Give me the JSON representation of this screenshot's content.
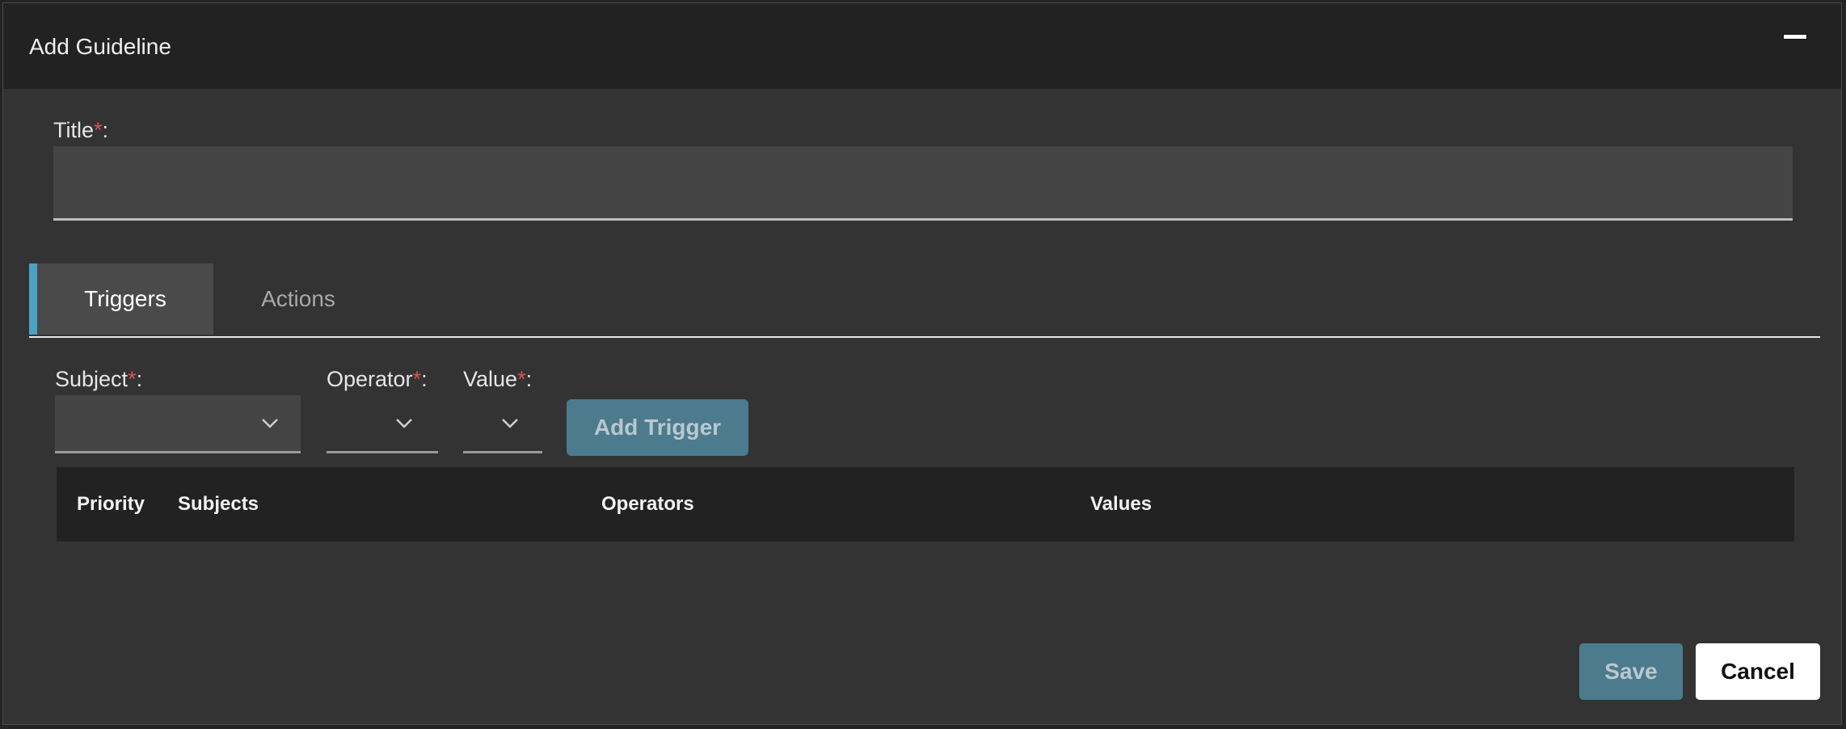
{
  "dialog": {
    "title": "Add Guideline"
  },
  "title_field": {
    "label": "Title",
    "required_mark": "*",
    "suffix": ":",
    "value": ""
  },
  "tabs": [
    {
      "label": "Triggers",
      "active": true
    },
    {
      "label": "Actions",
      "active": false
    }
  ],
  "trigger_form": {
    "subject": {
      "label": "Subject",
      "required_mark": "*",
      "suffix": ":",
      "value": ""
    },
    "operator": {
      "label": "Operator",
      "required_mark": "*",
      "suffix": ":",
      "value": ""
    },
    "value": {
      "label": "Value",
      "required_mark": "*",
      "suffix": ":",
      "value": ""
    },
    "add_button": "Add Trigger"
  },
  "table": {
    "columns": [
      "Priority",
      "Subjects",
      "Operators",
      "Values"
    ],
    "rows": []
  },
  "footer": {
    "save": "Save",
    "cancel": "Cancel"
  },
  "colors": {
    "accent": "#4aa3c4",
    "primary_button": "#4c7b8d",
    "required": "#d9534f"
  }
}
